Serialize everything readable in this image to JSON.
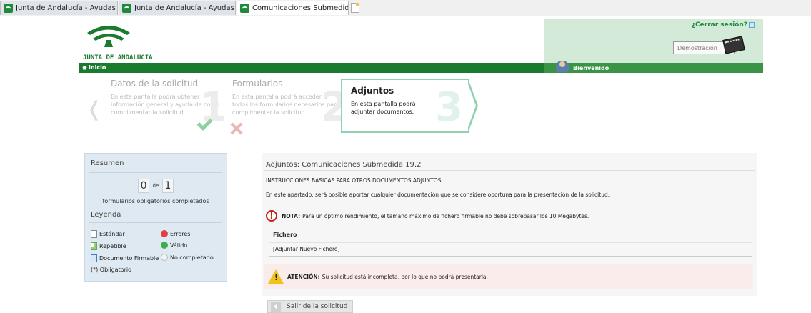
{
  "browser": {
    "tabs": [
      {
        "label": "Junta de Andalucía - Ayudas e..."
      },
      {
        "label": "Junta de Andalucía - Ayudas e..."
      },
      {
        "label": "Comunicaciones Submedid...",
        "close": "×"
      }
    ]
  },
  "header": {
    "logo_text": "JUNTA DE ANDALUCIA",
    "logout_label": "¿Cerrar sesión?",
    "demo_label": "Demostración",
    "nav_home": "Inicio",
    "welcome": "Bienvenido"
  },
  "steps": [
    {
      "title": "Datos de la solicitud",
      "text": "En esta pantalla podrá obtener información general y ayuda de como cumplimentar la solicitud.",
      "number": "1"
    },
    {
      "title": "Formularios",
      "text": "En esta pantalla podrá acceder a todos los formularios necesarios para cumplimentar la solicitud.",
      "number": "2"
    },
    {
      "title": "Adjuntos",
      "text": "En esta pantalla podrá adjuntar documentos.",
      "number": "3"
    }
  ],
  "summary": {
    "title": "Resumen",
    "completed": "0",
    "of": "de",
    "total": "1",
    "subtitle": "formularios obligatorios completados",
    "legend_title": "Leyenda",
    "legend": {
      "standard": "Estándar",
      "repeatable": "Repetible",
      "signable": "Documento Firmable",
      "errors": "Errores",
      "valid": "Válido",
      "not_completed": "No completado",
      "mandatory": "(*) Obligatorio"
    }
  },
  "main": {
    "title": "Adjuntos: Comunicaciones Submedida 19.2",
    "instructions": "INSTRUCCIONES BÁSICAS PARA OTROS DOCUMENTOS ADJUNTOS",
    "description": "En este apartado, será posible aportar cualquier documentación que se considere oportuna para la presentación de la solicitud.",
    "nota_label": "NOTA:",
    "nota_text": "Para un óptimo rendimiento, el tamaño máximo de fichero firmable no debe sobrepasar los 10 Megabytes.",
    "file_header": "Fichero",
    "attach_link": "[Adjuntar Nuevo Fichero]",
    "attention_label": "ATENCIÓN:",
    "attention_text": "Su solicitud está incompleta, por lo que no podrá presentarla."
  },
  "footer": {
    "exit_label": "Salir de la solicitud"
  },
  "colors": {
    "brand_green": "#1a7a2e",
    "header_light_green": "#d4ead8",
    "summary_bg": "#dfe9f1",
    "attention_bg": "#fbecec"
  }
}
